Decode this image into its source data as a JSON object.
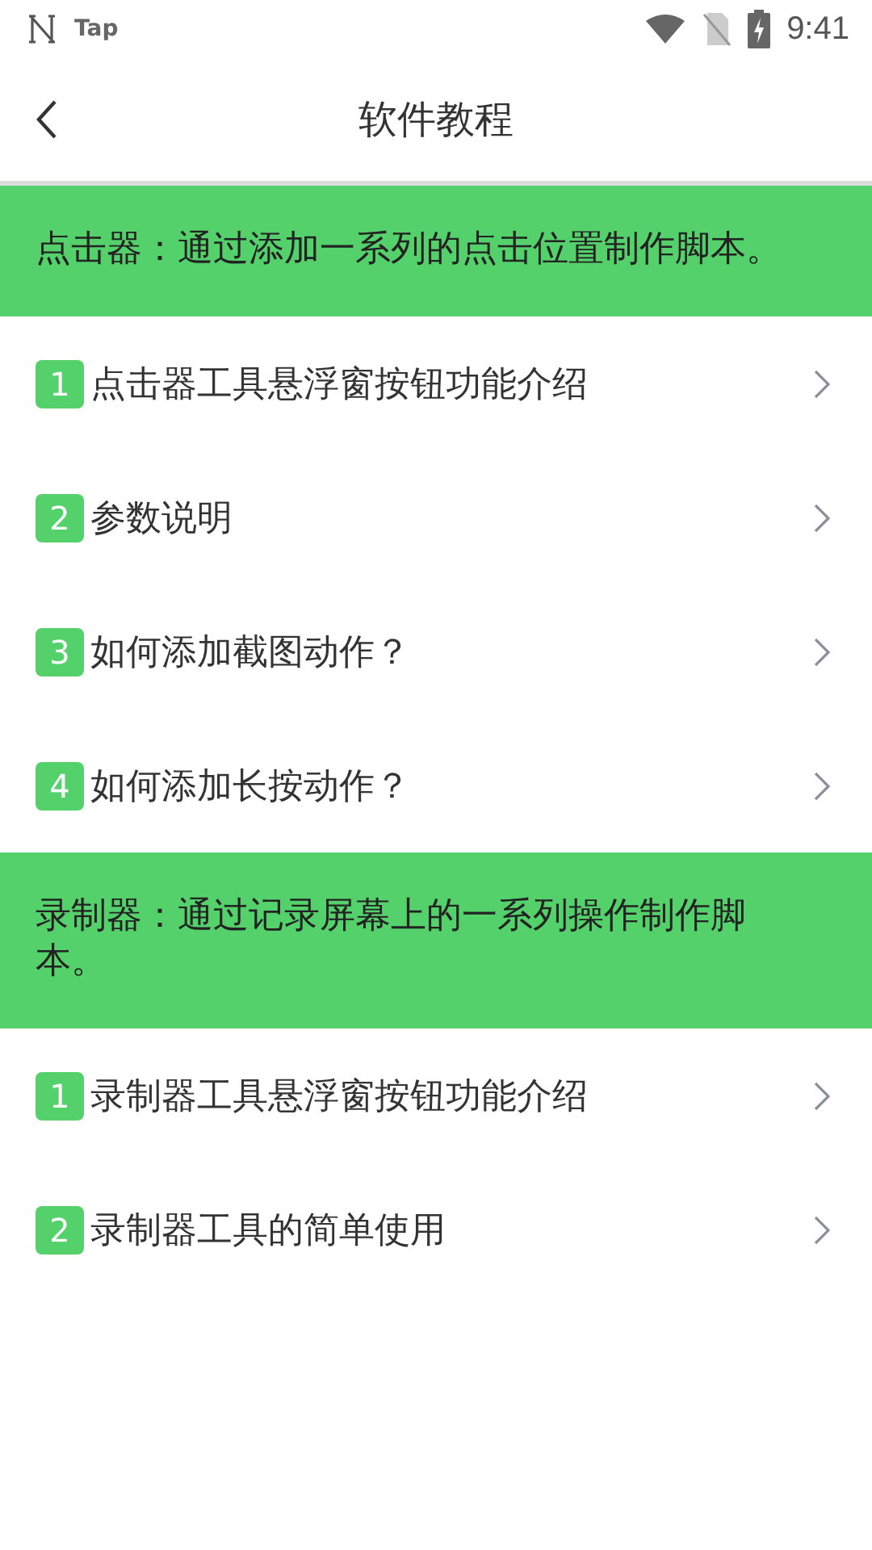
{
  "status_bar": {
    "app_label": "Tap",
    "time": "9:41"
  },
  "header": {
    "title": "软件教程"
  },
  "sections": [
    {
      "description": "点击器：通过添加一系列的点击位置制作脚本。",
      "items": [
        {
          "number": "1",
          "title": "点击器工具悬浮窗按钮功能介绍"
        },
        {
          "number": "2",
          "title": "参数说明"
        },
        {
          "number": "3",
          "title": "如何添加截图动作？"
        },
        {
          "number": "4",
          "title": "如何添加长按动作？"
        }
      ]
    },
    {
      "description": "录制器：通过记录屏幕上的一系列操作制作脚本。",
      "items": [
        {
          "number": "1",
          "title": "录制器工具悬浮窗按钮功能介绍"
        },
        {
          "number": "2",
          "title": "录制器工具的简单使用"
        }
      ]
    }
  ]
}
